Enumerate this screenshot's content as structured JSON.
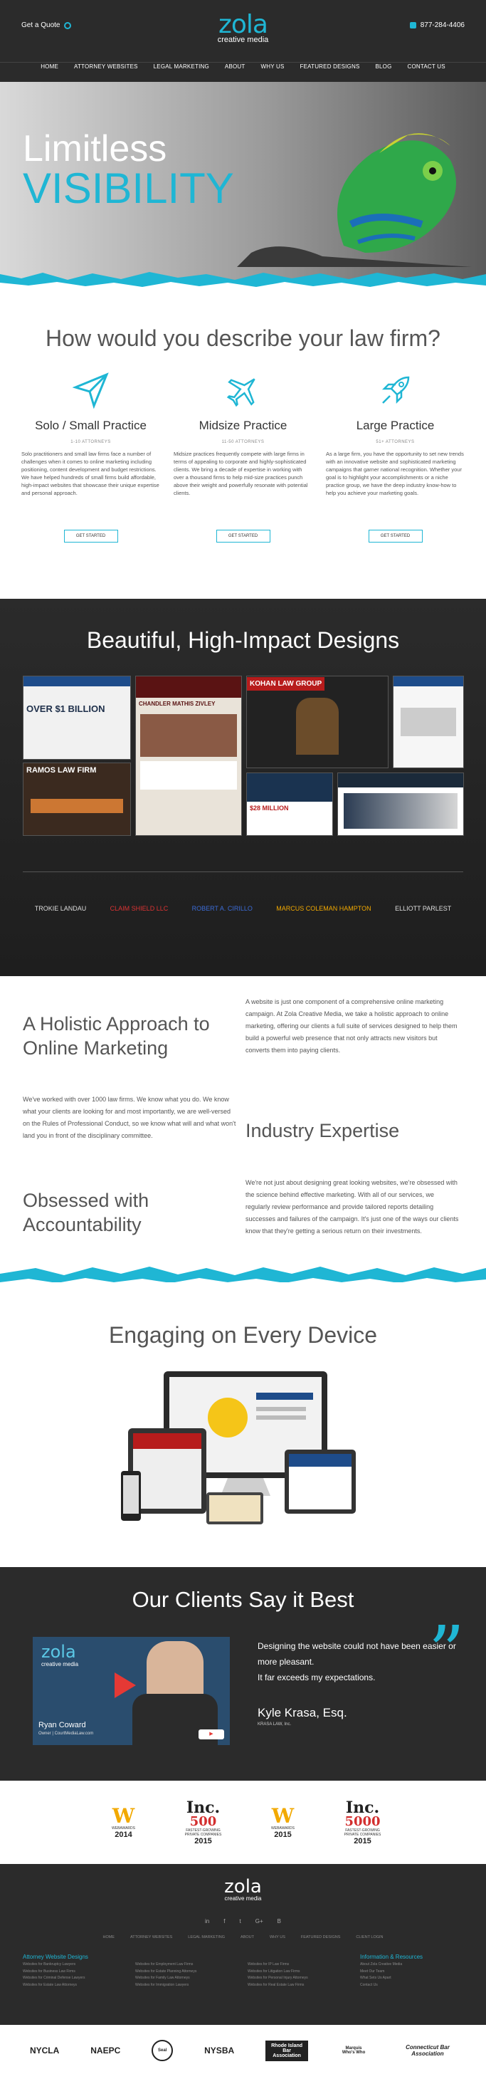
{
  "header": {
    "quote_label": "Get a Quote",
    "logo_word": "zola",
    "logo_sub": "creative media",
    "phone": "877-284-4406",
    "nav": [
      "HOME",
      "ATTORNEY WEBSITES",
      "LEGAL MARKETING",
      "ABOUT",
      "WHY US",
      "FEATURED DESIGNS",
      "BLOG",
      "CONTACT US"
    ]
  },
  "hero": {
    "line1": "Limitless",
    "line2": "VISIBILITY"
  },
  "practice": {
    "title": "How would you describe your law firm?",
    "cards": [
      {
        "icon": "paper-plane-icon",
        "title": "Solo / Small Practice",
        "sub": "1-10 ATTORNEYS",
        "text": "Solo practitioners and small law firms face a number of challenges when it comes to online marketing including positioning, content development and budget restrictions. We have helped hundreds of small firms build affordable, high-impact websites that showcase their unique expertise and personal approach.",
        "btn": "GET STARTED"
      },
      {
        "icon": "airplane-icon",
        "title": "Midsize Practice",
        "sub": "11-50 ATTORNEYS",
        "text": "Midsize practices frequently compete with large firms in terms of appealing to corporate and highly-sophisticated clients. We bring a decade of expertise in working with over a thousand firms to help mid-size practices punch above their weight and powerfully resonate with potential clients.",
        "btn": "GET STARTED"
      },
      {
        "icon": "rocket-icon",
        "title": "Large Practice",
        "sub": "51+ ATTORNEYS",
        "text": "As a large firm, you have the opportunity to set new trends with an innovative website and sophisticated marketing campaigns that garner national recognition. Whether your goal is to highlight your accomplishments or a niche practice group, we have the deep industry know-how to help you achieve your marketing goals.",
        "btn": "GET STARTED"
      }
    ]
  },
  "designs": {
    "title": "Beautiful, High-Impact Designs",
    "shot_texts": [
      "OVER $1 BILLION",
      "RAMOS LAW FIRM",
      "CHANDLER MATHIS ZIVLEY",
      "KOHAN LAW GROUP",
      "$28 MILLION"
    ],
    "client_logos": [
      "TROKIE LANDAU",
      "CLAIM SHIELD LLC",
      "ROBERT A. CIRILLO",
      "MARCUS COLEMAN HAMPTON",
      "ELLIOTT PARLEST"
    ]
  },
  "holistic": {
    "h1": "A Holistic Approach to Online Marketing",
    "p1": "A website is just one component of a comprehensive online marketing campaign. At Zola Creative Media, we take a holistic approach to online marketing, offering our clients a full suite of services designed to help them build a powerful web presence that not only attracts new visitors but converts them into paying clients.",
    "p2": "We've worked with over 1000 law firms. We know what you do. We know what your clients are looking for and most importantly, we are well-versed on the Rules of Professional Conduct, so we know what will and what won't land you in front of the disciplinary committee.",
    "h2": "Industry Expertise",
    "h3": "Obsessed with Accountability",
    "p3": "We're not just about designing great looking websites, we're obsessed with the science behind effective marketing. With all of our services, we regularly review performance and provide tailored reports detailing successes and failures of the campaign. It's just one of the ways our clients know that they're getting a serious return on their investments."
  },
  "devices": {
    "title": "Engaging on Every Device"
  },
  "testimonial": {
    "title": "Our Clients Say it Best",
    "video_logo": "zola",
    "video_logo_sub": "creative media",
    "video_name": "Ryan Coward",
    "video_role": "Owner | CourtMediaLaw.com",
    "quote": "Designing the website could not have been easier or more pleasant.\nIt far exceeds my expectations.",
    "author": "Kyle Krasa, Esq.",
    "firm": "KRASA LAW, Inc."
  },
  "awards": [
    {
      "kind": "W",
      "year": "2014",
      "label": "WEBAWARDS"
    },
    {
      "kind": "Inc.",
      "year": "2015",
      "label": "FASTEST-GROWING PRIVATE COMPANIES"
    },
    {
      "kind": "W",
      "year": "2015",
      "label": "WEBAWARDS"
    },
    {
      "kind": "Inc.",
      "year": "2015",
      "label": "FASTEST-GROWING PRIVATE COMPANIES"
    }
  ],
  "footer": {
    "logo_word": "zola",
    "logo_sub": "creative media",
    "social": [
      "in",
      "f",
      "t",
      "G+",
      "B"
    ],
    "nav": [
      "HOME",
      "ATTORNEY WEBSITES",
      "LEGAL MARKETING",
      "ABOUT",
      "WHY US",
      "FEATURED DESIGNS",
      "CLIENT LOGIN"
    ],
    "col1_head": "Attorney Website Designs",
    "col1": [
      "Websites for Bankruptcy Lawyers",
      "Websites for Business Law Firms",
      "Websites for Criminal Defense Lawyers",
      "Websites for Estate Law Attorneys"
    ],
    "col2": [
      "Websites for Employment Law Firms",
      "Websites for Estate Planning Attorneys",
      "Websites for Family Law Attorneys",
      "Websites for Immigration Lawyers"
    ],
    "col3": [
      "Websites for IP Law Firms",
      "Websites for Litigation Law Firms",
      "Websites for Personal Injury Attorneys",
      "Websites for Real Estate Law Firms"
    ],
    "col4_head": "Information & Resources",
    "col4": [
      "About Zola Creative Media",
      "Meet Our Team",
      "What Sets Us Apart",
      "Contact Us"
    ]
  },
  "associations": [
    "NYCLA",
    "NAEPC",
    "Seal",
    "NYSBA",
    "Rhode Island Bar Association",
    "Marquis Who's Who",
    "Connecticut Bar Association"
  ]
}
